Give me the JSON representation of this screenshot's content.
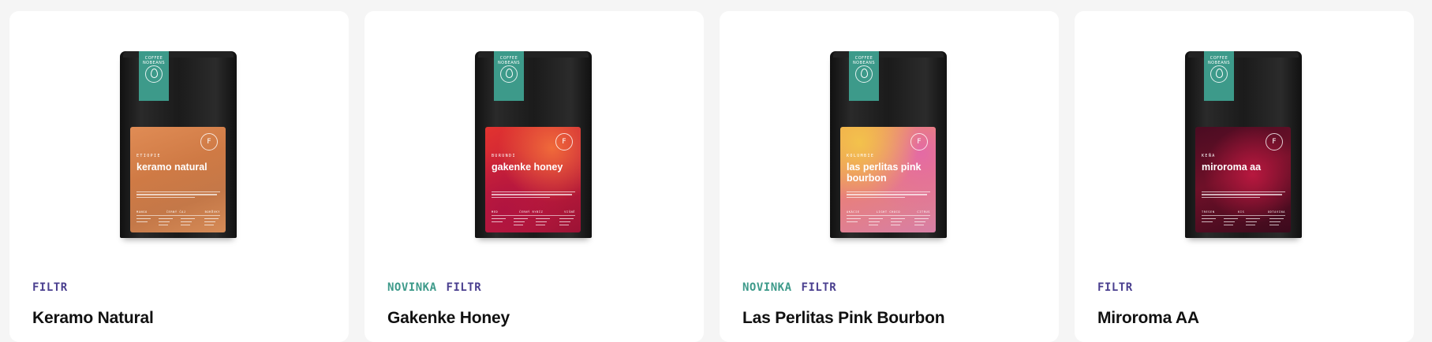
{
  "products": [
    {
      "badges": [
        "FILTR"
      ],
      "title": "Keramo Natural",
      "package": {
        "brand": "COFFEE NOBEANS",
        "country": "ETIOPIE",
        "name": "keramo natural",
        "color": "#d8824d",
        "notes": [
          "MANGO",
          "ČERNÝ ČAJ",
          "BORŮVKY"
        ]
      }
    },
    {
      "badges": [
        "NOVINKA",
        "FILTR"
      ],
      "title": "Gakenke Honey",
      "package": {
        "brand": "COFFEE NOBEANS",
        "country": "BURUNDI",
        "name": "gakenke honey",
        "color": "#c51d3a",
        "notes": [
          "MED",
          "ČERNÝ RYBÍZ",
          "VIŠNĚ"
        ]
      }
    },
    {
      "badges": [
        "NOVINKA",
        "FILTR"
      ],
      "title": "Las Perlitas Pink Bourbon",
      "package": {
        "brand": "COFFEE NOBEANS",
        "country": "KOLUMBIE",
        "name": "las perlitas pink bourbon",
        "color": "#e8917a",
        "notes": [
          "AKÁCIE",
          "LIGHT CHOCO",
          "CITRUS"
        ]
      }
    },
    {
      "badges": [
        "FILTR"
      ],
      "title": "Miroroma AA",
      "package": {
        "brand": "COFFEE NOBEANS",
        "country": "KEŇA",
        "name": "miroroma aa",
        "color": "#7a1230",
        "notes": [
          "TRESEN",
          "KIS",
          "ODTAVINA"
        ]
      }
    }
  ],
  "colors": {
    "accent_green": "#3d9a8a",
    "accent_purple": "#4a3f8f",
    "page_background": "#f5f5f5",
    "card_background": "#ffffff",
    "title": "#111111"
  }
}
